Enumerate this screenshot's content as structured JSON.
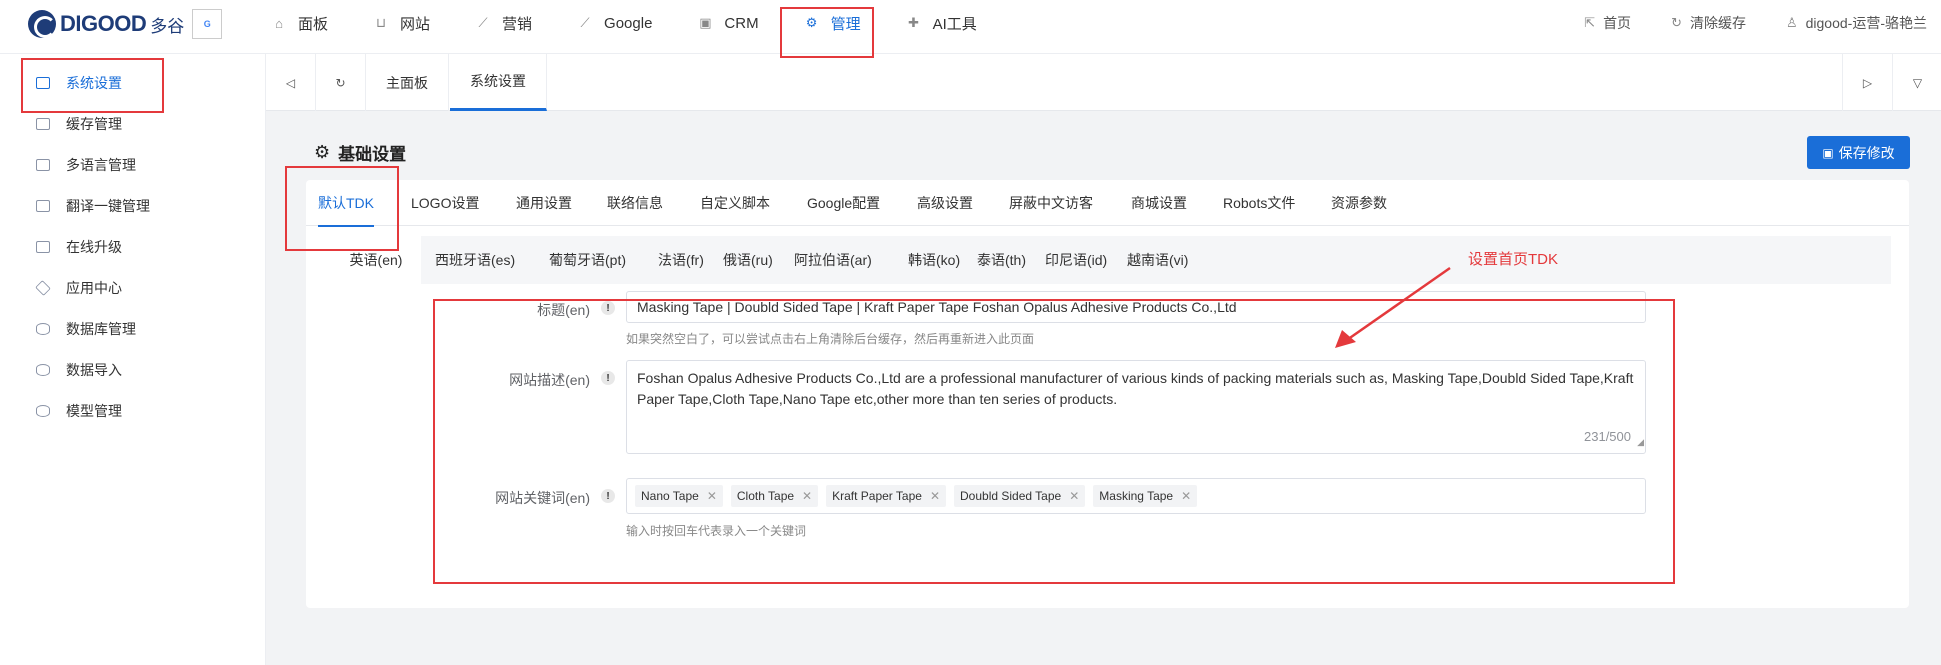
{
  "brand": {
    "logo_text": "DIGOOD",
    "logo_cn": "多谷",
    "badge_text": "G"
  },
  "nav": [
    {
      "label": "面板",
      "icon": "home-icon",
      "glyph": "⌂"
    },
    {
      "label": "网站",
      "icon": "basket-icon",
      "glyph": "⊔"
    },
    {
      "label": "营销",
      "icon": "chart-line-icon",
      "glyph": "⟋"
    },
    {
      "label": "Google",
      "icon": "trend-icon",
      "glyph": "⟋"
    },
    {
      "label": "CRM",
      "icon": "crm-icon",
      "glyph": "▣"
    },
    {
      "label": "管理",
      "icon": "gear-icon",
      "glyph": "⚙"
    },
    {
      "label": "AI工具",
      "icon": "puzzle-icon",
      "glyph": "✚"
    }
  ],
  "top_right": [
    {
      "label": "首页",
      "icon": "external-link-icon",
      "glyph": "⇱"
    },
    {
      "label": "清除缓存",
      "icon": "refresh-icon",
      "glyph": "↻"
    },
    {
      "label": "digood-运营-骆艳兰",
      "icon": "user-icon",
      "glyph": "♙"
    }
  ],
  "sidebar": [
    {
      "label": "系统设置",
      "icon": "monitor-icon",
      "active": true
    },
    {
      "label": "缓存管理",
      "icon": "monitor-icon"
    },
    {
      "label": "多语言管理",
      "icon": "monitor-icon"
    },
    {
      "label": "翻译一键管理",
      "icon": "monitor-icon"
    },
    {
      "label": "在线升级",
      "icon": "monitor-icon"
    },
    {
      "label": "应用中心",
      "icon": "box-icon"
    },
    {
      "label": "数据库管理",
      "icon": "database-icon"
    },
    {
      "label": "数据导入",
      "icon": "database-icon"
    },
    {
      "label": "模型管理",
      "icon": "database-icon"
    }
  ],
  "tabbar": {
    "tabs": [
      "主面板",
      "系统设置"
    ],
    "active": 1
  },
  "page": {
    "title": "基础设置",
    "save_label": "保存修改"
  },
  "main_tabs": [
    "默认TDK",
    "LOGO设置",
    "通用设置",
    "联络信息",
    "自定义脚本",
    "Google配置",
    "高级设置",
    "屏蔽中文访客",
    "商城设置",
    "Robots文件",
    "资源参数"
  ],
  "lang_tabs": [
    "英语(en)",
    "西班牙语(es)",
    "葡萄牙语(pt)",
    "法语(fr)",
    "俄语(ru)",
    "阿拉伯语(ar)",
    "韩语(ko)",
    "泰语(th)",
    "印尼语(id)",
    "越南语(vi)"
  ],
  "form": {
    "title_label": "标题(en)",
    "title_value": "Masking Tape | Doubld Sided Tape | Kraft Paper Tape Foshan Opalus Adhesive Products Co.,Ltd",
    "title_hint": "如果突然空白了，可以尝试点击右上角清除后台缓存，然后再重新进入此页面",
    "desc_label": "网站描述(en)",
    "desc_value": "Foshan Opalus Adhesive Products Co.,Ltd are a professional manufacturer of various kinds of packing materials such as, Masking Tape,Doubld Sided Tape,Kraft Paper Tape,Cloth Tape,Nano Tape etc,other more than ten series of products.",
    "desc_count": "231/500",
    "kw_label": "网站关键词(en)",
    "keywords": [
      "Nano Tape",
      "Cloth Tape",
      "Kraft Paper Tape",
      "Doubld Sided Tape",
      "Masking Tape"
    ],
    "kw_hint": "输入时按回车代表录入一个关键词"
  },
  "annotation": {
    "text": "设置首页TDK"
  },
  "colors": {
    "accent": "#1a6ed8",
    "highlight": "#e4393c"
  }
}
